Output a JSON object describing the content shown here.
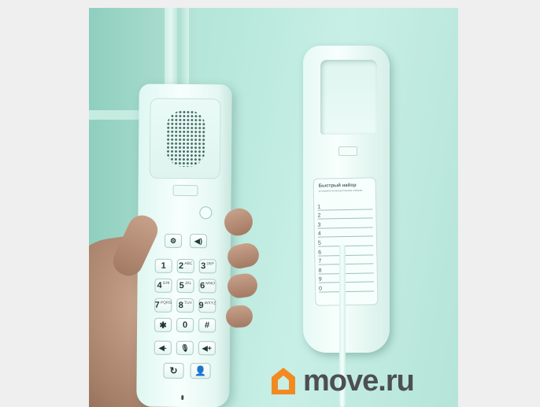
{
  "logo": {
    "text": "move.ru",
    "house_color": "#f28a22",
    "text_color": "#4d4f55"
  },
  "cradle_card": {
    "title": "Быстрый набор",
    "subtitle": "установите кнопки для вызова номеров",
    "lines": [
      "1",
      "2",
      "3",
      "4",
      "5",
      "6",
      "7",
      "8",
      "9",
      "0"
    ]
  },
  "handset": {
    "function_keys": [
      {
        "name": "redial-settings-icon",
        "glyph": "⚙"
      },
      {
        "name": "speaker-icon",
        "glyph": "◀)"
      }
    ],
    "dial_keys": [
      {
        "main": "1",
        "sub": ""
      },
      {
        "main": "2",
        "sub": "ABC"
      },
      {
        "main": "3",
        "sub": "DEF"
      },
      {
        "main": "4",
        "sub": "GHI"
      },
      {
        "main": "5",
        "sub": "JKL"
      },
      {
        "main": "6",
        "sub": "MNO"
      },
      {
        "main": "7",
        "sub": "PQRS"
      },
      {
        "main": "8",
        "sub": "TUV"
      },
      {
        "main": "9",
        "sub": "WXYZ"
      },
      {
        "main": "✱",
        "sub": ""
      },
      {
        "main": "0",
        "sub": ""
      },
      {
        "main": "#",
        "sub": ""
      }
    ],
    "bottom_keys": [
      {
        "name": "volume-down-icon",
        "glyph": "◀-"
      },
      {
        "name": "mute-icon",
        "glyph": "🎙"
      },
      {
        "name": "volume-up-icon",
        "glyph": "◀+"
      },
      {
        "name": "redial-icon",
        "glyph": "↻"
      },
      {
        "name": "contact-icon",
        "glyph": "👤"
      }
    ]
  }
}
